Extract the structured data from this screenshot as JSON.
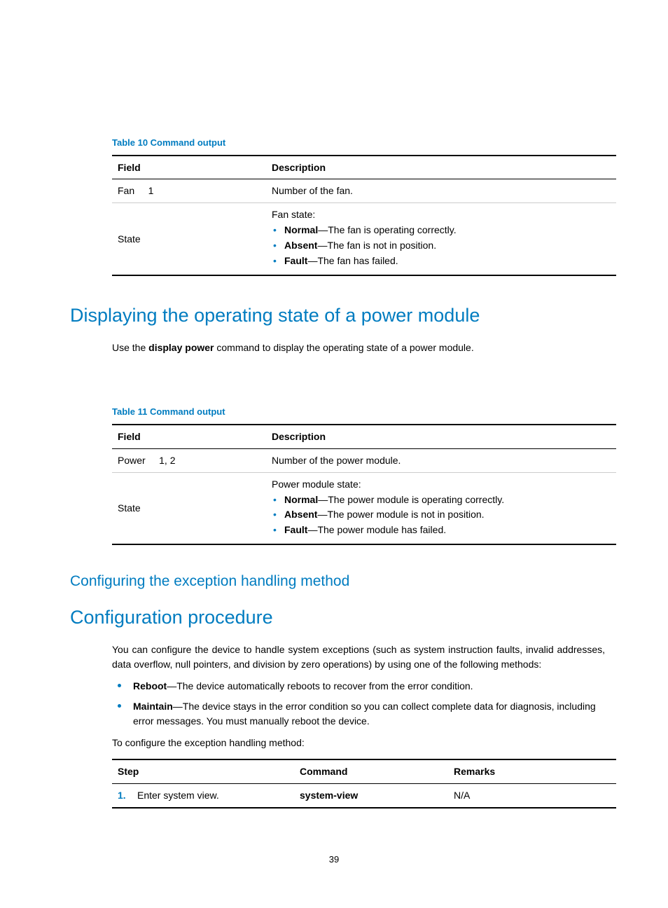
{
  "page_number": "39",
  "table10": {
    "caption": "Table 10 Command output",
    "headers": {
      "field": "Field",
      "desc": "Description"
    },
    "rows": [
      {
        "field": "Fan     1",
        "desc": "Number of the fan."
      }
    ],
    "state_row": {
      "field": "State",
      "title": "Fan state:",
      "items": [
        {
          "name": "Normal",
          "text": "—The fan is operating correctly."
        },
        {
          "name": "Absent",
          "text": "—The fan is not in position."
        },
        {
          "name": "Fault",
          "text": "—The fan has failed."
        }
      ]
    }
  },
  "section_power": {
    "heading": "Displaying the operating state of a power module",
    "intro_pre": "Use the ",
    "intro_cmd": "display power",
    "intro_post": " command to display the operating state of a power module."
  },
  "table11": {
    "caption": "Table 11 Command output",
    "headers": {
      "field": "Field",
      "desc": "Description"
    },
    "rows": [
      {
        "field": "Power     1, 2",
        "desc": "Number of the power module."
      }
    ],
    "state_row": {
      "field": "State",
      "title": "Power module state:",
      "items": [
        {
          "name": "Normal",
          "text": "—The power module is operating correctly."
        },
        {
          "name": "Absent",
          "text": "—The power module is not in position."
        },
        {
          "name": "Fault",
          "text": "—The power module has failed."
        }
      ]
    }
  },
  "section_exception": {
    "main_heading": "Configuring the exception handling method",
    "sub_heading": "Configuration procedure",
    "intro": "You can configure the device to handle system exceptions (such as system instruction faults, invalid addresses, data overflow, null pointers, and division by zero operations) by using one of the following methods:",
    "bullets": [
      {
        "name": "Reboot",
        "text": "—The device automatically reboots to recover from the error condition."
      },
      {
        "name": "Maintain",
        "text": "—The device stays in the error condition so you can collect complete data for diagnosis, including error messages. You must manually reboot the device."
      }
    ],
    "config_intro": "To configure the exception handling method:"
  },
  "step_table": {
    "headers": {
      "step": "Step",
      "command": "Command",
      "remarks": "Remarks"
    },
    "row": {
      "num": "1.",
      "step": "Enter system view.",
      "command": "system-view",
      "remarks": "N/A"
    }
  }
}
